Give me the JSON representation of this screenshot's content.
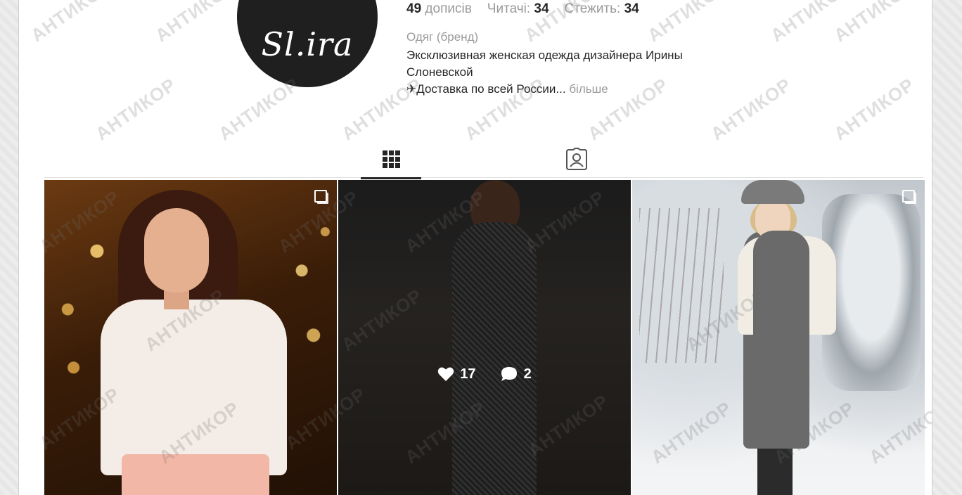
{
  "profile": {
    "avatar_text": "Sl.ira",
    "posts_count": "49",
    "posts_label": "дописів",
    "followers_label": "Читачі:",
    "followers_count": "34",
    "following_label": "Стежить:",
    "following_count": "34",
    "category": "Одяг (бренд)",
    "bio_line1": "Эксклюзивная женская одежда дизайнера Ирины Слоневской",
    "bio_line2": "✈Доставка по всей России...",
    "more_label": "більше"
  },
  "tabs": [
    {
      "icon": "grid-icon",
      "active": true
    },
    {
      "icon": "tagged-icon",
      "active": false
    }
  ],
  "posts": [
    {
      "kind": "multi-photo",
      "likes": null,
      "comments": null
    },
    {
      "kind": "photo",
      "likes": "17",
      "comments": "2"
    },
    {
      "kind": "multi-photo",
      "likes": null,
      "comments": null
    }
  ],
  "watermark": "АНТИКОР"
}
